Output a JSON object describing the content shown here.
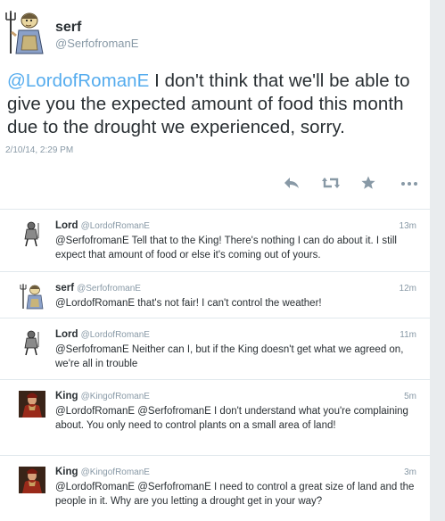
{
  "main_tweet": {
    "name": "serf",
    "handle": "@SerfofromanE",
    "mention": "@LordofRomanE",
    "text": " I don't think that we'll be able to give you the expected amount of food this month due to the drought we experienced, sorry.",
    "timestamp": "2/10/14, 2:29 PM",
    "avatar_icon": "serf-peasant-avatar-icon"
  },
  "actions": {
    "reply_icon": "reply-icon",
    "retweet_icon": "retweet-icon",
    "favorite_icon": "favorite-icon",
    "more_icon": "more-icon"
  },
  "replies": [
    {
      "name": "Lord",
      "handle": "@LordofRomanE",
      "time": "13m",
      "text": "@SerfofromanE Tell that to the King! There's nothing I can do about it. I still expect that amount of food or else it's coming out of yours.",
      "avatar_icon": "knight-avatar-icon"
    },
    {
      "name": "serf",
      "handle": "@SerfofromanE",
      "time": "12m",
      "text": "@LordofRomanE that's not fair! I can't control the weather!",
      "avatar_icon": "serf-peasant-avatar-icon"
    },
    {
      "name": "Lord",
      "handle": "@LordofRomanE",
      "time": "11m",
      "text": "@SerfofromanE Neither can I, but if the King doesn't get what we agreed on, we're all in trouble",
      "avatar_icon": "knight-avatar-icon"
    },
    {
      "name": "King",
      "handle": "@KingofRomanE",
      "time": "5m",
      "text": "@LordofRomanE @SerfofromanE I don't understand what you're complaining about. You only need to control plants on a small area of land!",
      "avatar_icon": "king-portrait-avatar-icon"
    },
    {
      "name": "King",
      "handle": "@KingofRomanE",
      "time": "3m",
      "text": "@LordofRomanE @SerfofromanE I need to control a great size of land and the people in it. Why are you letting a drought get in your way?",
      "avatar_icon": "king-portrait-avatar-icon"
    }
  ],
  "colors": {
    "link": "#55acee",
    "muted": "#8899a6",
    "text": "#292f33",
    "divider": "#e1e8ed"
  }
}
